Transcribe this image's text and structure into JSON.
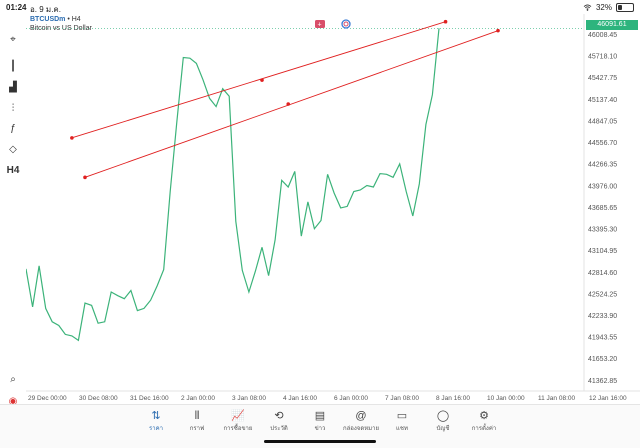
{
  "status_bar": {
    "time": "01:24",
    "date": "อ. 9 ม.ค.",
    "battery": "32%",
    "battery_level": 0.32
  },
  "chart_header": {
    "symbol": "BTCUSDm",
    "timeframe": "H4",
    "description": "Bitcoin vs US Dollar"
  },
  "current_price": "46091.61",
  "left_tools": [
    {
      "name": "crosshair-icon",
      "glyph": "⌖"
    },
    {
      "name": "candles-icon",
      "glyph": "┃"
    },
    {
      "name": "indicators-icon",
      "glyph": "▟"
    },
    {
      "name": "tune-icon",
      "glyph": "⫶"
    },
    {
      "name": "function-icon",
      "glyph": "ƒ"
    },
    {
      "name": "shapes-icon",
      "glyph": "◇"
    },
    {
      "name": "timeframe-button",
      "glyph": "H4"
    }
  ],
  "bottom_left_tools": [
    {
      "name": "zoom-icon",
      "glyph": "⌕"
    },
    {
      "name": "broker-logo-icon",
      "glyph": "◉"
    }
  ],
  "tabs": [
    {
      "label": "ราคา",
      "icon": "quotes-icon",
      "glyph": "⇅",
      "active": true
    },
    {
      "label": "กราฟ",
      "icon": "chart-icon",
      "glyph": "⫴",
      "active": false
    },
    {
      "label": "การซื้อขาย",
      "icon": "trade-icon",
      "glyph": "📈",
      "active": false
    },
    {
      "label": "ประวัติ",
      "icon": "history-icon",
      "glyph": "⟲",
      "active": false
    },
    {
      "label": "ข่าว",
      "icon": "news-icon",
      "glyph": "▤",
      "active": false
    },
    {
      "label": "กล่องจดหมาย",
      "icon": "mailbox-icon",
      "glyph": "@",
      "active": false
    },
    {
      "label": "แชท",
      "icon": "chat-icon",
      "glyph": "▭",
      "active": false
    },
    {
      "label": "บัญชี",
      "icon": "account-icon",
      "glyph": "◯",
      "active": false
    },
    {
      "label": "การตั้งค่า",
      "icon": "settings-icon",
      "glyph": "⚙",
      "active": false
    }
  ],
  "chart_data": {
    "type": "line",
    "color": "#3cb37a",
    "y_ticks": [
      "46008.45",
      "45718.10",
      "45427.75",
      "45137.40",
      "44847.05",
      "44556.70",
      "44266.35",
      "43976.00",
      "43685.65",
      "43395.30",
      "43104.95",
      "42814.60",
      "42524.25",
      "42233.90",
      "41943.55",
      "41653.20",
      "41362.85"
    ],
    "ylim": [
      41220,
      46230
    ],
    "x_ticks": [
      "29 Dec 00:00",
      "30 Dec 08:00",
      "31 Dec 16:00",
      "2 Jan 00:00",
      "3 Jan 08:00",
      "4 Jan 16:00",
      "6 Jan 00:00",
      "7 Jan 08:00",
      "8 Jan 16:00",
      "10 Jan 00:00",
      "11 Jan 08:00",
      "12 Jan 16:00"
    ],
    "values": [
      42860,
      42350,
      42900,
      42330,
      42150,
      42100,
      41980,
      41960,
      41900,
      42400,
      42370,
      42130,
      42150,
      42550,
      42500,
      42460,
      42570,
      42300,
      42330,
      42440,
      42630,
      42850,
      43900,
      44830,
      45700,
      45690,
      45620,
      45400,
      45150,
      45040,
      45280,
      45180,
      43500,
      42840,
      42550,
      42830,
      43150,
      42770,
      43250,
      44050,
      43960,
      44170,
      43300,
      43760,
      43400,
      43510,
      44130,
      43880,
      43680,
      43700,
      43900,
      43920,
      43980,
      43960,
      44140,
      44130,
      44090,
      44270,
      43900,
      43570,
      44000,
      44800,
      45200,
      46091
    ],
    "last_price": 46091.61,
    "channel_lines": [
      {
        "x1_index": 7,
        "y1": 44620,
        "x2_index": 64,
        "y2": 46180,
        "mid_index": 36,
        "mid_y": 45395
      },
      {
        "x1_index": 9,
        "y1": 44090,
        "x2_index": 72,
        "y2": 46060,
        "mid_index": 40,
        "mid_y": 45075
      }
    ],
    "channel_color": "#e02020"
  }
}
